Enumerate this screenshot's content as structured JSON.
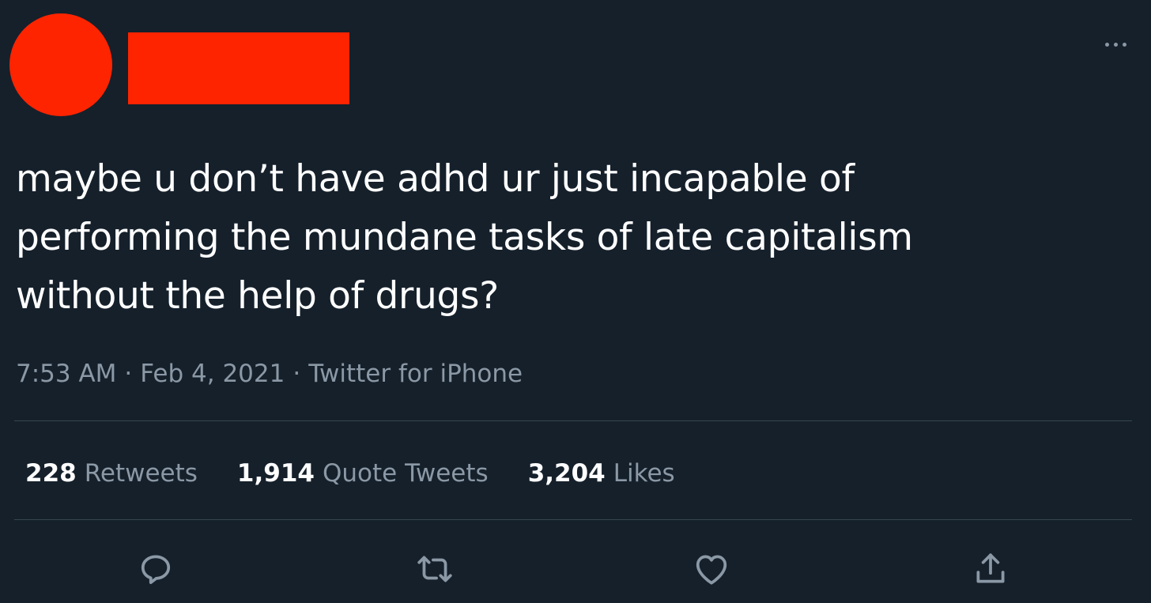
{
  "tweet": {
    "text_lines": [
      "maybe u don’t have adhd ur just incapable of",
      "performing the mundane tasks of late capitalism",
      "without the help of drugs?"
    ],
    "time": "7:53 AM",
    "separator": "·",
    "date": "Feb 4, 2021",
    "source": "Twitter for iPhone"
  },
  "stats": {
    "retweets": {
      "count": "228",
      "label": "Retweets"
    },
    "quote_tweets": {
      "count": "1,914",
      "label": "Quote Tweets"
    },
    "likes": {
      "count": "3,204",
      "label": "Likes"
    }
  },
  "actions": {
    "reply_icon": "reply-icon",
    "retweet_icon": "retweet-icon",
    "like_icon": "heart-icon",
    "share_icon": "share-icon"
  },
  "colors": {
    "background": "#15202b",
    "redaction": "#ff2400",
    "secondary_text": "#8b98a5",
    "divider": "#38444d"
  }
}
